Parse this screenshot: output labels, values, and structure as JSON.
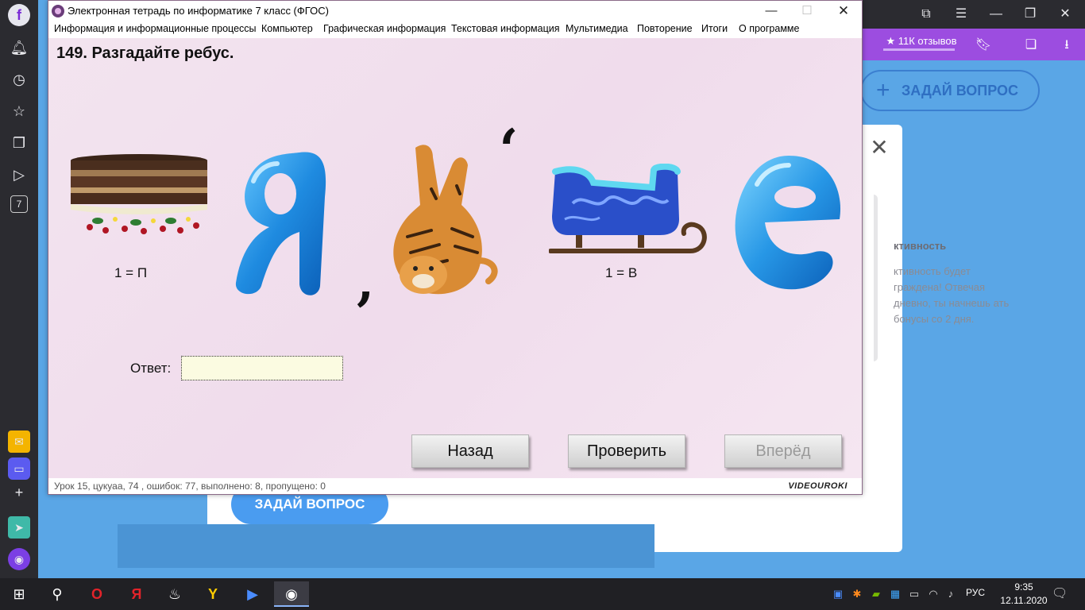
{
  "window": {
    "title": "Электронная тетрадь по информатике 7 класс (ФГОС)",
    "minimize": "—",
    "maximize": "☐",
    "close": "✕"
  },
  "menu": [
    "Информация и информационные процессы",
    "Компьютер",
    "Графическая информация",
    "Текстовая информация",
    "Мультимедиа",
    "Повторение",
    "Итоги",
    "О программе"
  ],
  "task": {
    "title": "149. Разгадайте ребус.",
    "hint_cake": "1 = П",
    "hint_sled": "1 = В",
    "comma_left": ",",
    "comma_right": ","
  },
  "answer": {
    "label": "Ответ:",
    "value": ""
  },
  "buttons": {
    "back": "Назад",
    "check": "Проверить",
    "forward": "Вперёд"
  },
  "status": {
    "text": "Урок 15, цукуаа, 74 , ошибок: 77, выполнено: 8, пропущено: 0",
    "brand": "VIDEOUROKI"
  },
  "background": {
    "reviews": "★ 11К отзывов",
    "ask_question": "ЗАДАЙ ВОПРОС",
    "activity_title": "ктивность",
    "activity_text": "ктивность будет граждена! Отвечая дневно, ты начнешь ать бонусы со 2 дня.",
    "modal_close": "✕"
  },
  "taskbar": {
    "lang": "РУС",
    "time": "9:35",
    "date": "12.11.2020"
  },
  "colors": {
    "accent": "#9c4de0",
    "page_bg": "#5aa6e6",
    "app_bg": "#f2e5ef",
    "answer_bg": "#fbfbe1"
  }
}
